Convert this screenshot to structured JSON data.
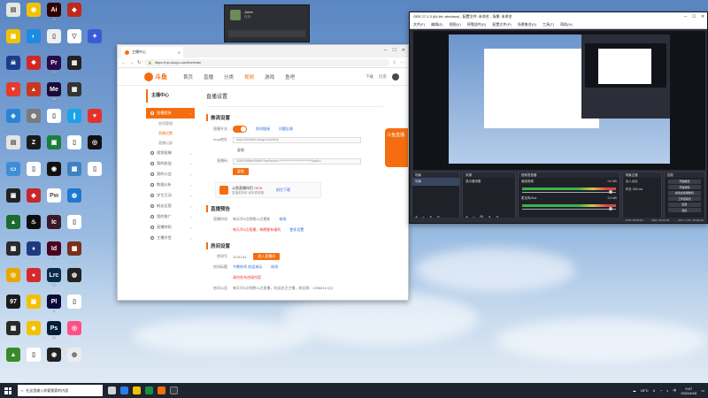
{
  "desktop_icons": [
    {
      "label": "",
      "color": "#e6e6e6",
      "glyph": "▤",
      "col": 0,
      "row": 0
    },
    {
      "label": "",
      "color": "#f2c200",
      "glyph": "◉",
      "col": 1,
      "row": 0
    },
    {
      "label": "Ai",
      "color": "#330000",
      "glyph": "Ai",
      "col": 2,
      "row": 0
    },
    {
      "label": "",
      "color": "#c2271d",
      "glyph": "◆",
      "col": 3,
      "row": 0
    },
    {
      "label": "",
      "color": "#f2c200",
      "glyph": "▣",
      "col": 0,
      "row": 1
    },
    {
      "label": "",
      "color": "#1e8ae0",
      "glyph": "◐",
      "col": 1,
      "row": 1
    },
    {
      "label": "",
      "color": "#f0f0f0",
      "glyph": "▯",
      "col": 2,
      "row": 1
    },
    {
      "label": "",
      "color": "#ffffff",
      "glyph": "▽",
      "col": 3,
      "row": 1
    },
    {
      "label": "",
      "color": "#3a5bd6",
      "glyph": "✦",
      "col": 4,
      "row": 1
    },
    {
      "label": "",
      "color": "#1c3d8c",
      "glyph": "☠",
      "col": 0,
      "row": 2
    },
    {
      "label": "",
      "color": "#d02828",
      "glyph": "❖",
      "col": 1,
      "row": 2
    },
    {
      "label": "Pr",
      "color": "#2a0a4a",
      "glyph": "Pr",
      "col": 2,
      "row": 2
    },
    {
      "label": "",
      "color": "#222222",
      "glyph": "▦",
      "col": 3,
      "row": 2
    },
    {
      "label": "",
      "color": "#e63a2e",
      "glyph": "▼",
      "col": 0,
      "row": 3
    },
    {
      "label": "",
      "color": "#c9381d",
      "glyph": "▲",
      "col": 1,
      "row": 3
    },
    {
      "label": "Me",
      "color": "#1a0a3a",
      "glyph": "Me",
      "col": 2,
      "row": 3
    },
    {
      "label": "",
      "color": "#333333",
      "glyph": "▦",
      "col": 3,
      "row": 3
    },
    {
      "label": "",
      "color": "#2a84d6",
      "glyph": "◈",
      "col": 0,
      "row": 4
    },
    {
      "label": "",
      "color": "#7a7a7a",
      "glyph": "◍",
      "col": 1,
      "row": 4
    },
    {
      "label": "",
      "color": "#ffffff",
      "glyph": "▯",
      "col": 2,
      "row": 4
    },
    {
      "label": "",
      "color": "#1aa3e8",
      "glyph": "❙",
      "col": 3,
      "row": 4
    },
    {
      "label": "",
      "color": "#e2322a",
      "glyph": "♥",
      "col": 4,
      "row": 4
    },
    {
      "label": "",
      "color": "#e5e5e5",
      "glyph": "▤",
      "col": 0,
      "row": 5
    },
    {
      "label": "",
      "color": "#1b1b1b",
      "glyph": "Z",
      "col": 1,
      "row": 5
    },
    {
      "label": "",
      "color": "#1a7f3a",
      "glyph": "▣",
      "col": 2,
      "row": 5
    },
    {
      "label": "",
      "color": "#ffffff",
      "glyph": "▯",
      "col": 3,
      "row": 5
    },
    {
      "label": "",
      "color": "#111111",
      "glyph": "◎",
      "col": 4,
      "row": 5
    },
    {
      "label": "",
      "color": "#3c8fd6",
      "glyph": "▭",
      "col": 0,
      "row": 6
    },
    {
      "label": "",
      "color": "#ffffff",
      "glyph": "▯",
      "col": 1,
      "row": 6
    },
    {
      "label": "",
      "color": "#111111",
      "glyph": "◉",
      "col": 2,
      "row": 6
    },
    {
      "label": "",
      "color": "#3b82c4",
      "glyph": "▦",
      "col": 3,
      "row": 6
    },
    {
      "label": "",
      "color": "#ffffff",
      "glyph": "▯",
      "col": 4,
      "row": 6
    },
    {
      "label": "",
      "color": "#232323",
      "glyph": "▣",
      "col": 0,
      "row": 7
    },
    {
      "label": "",
      "color": "#c62828",
      "glyph": "◆",
      "col": 1,
      "row": 7
    },
    {
      "label": "",
      "color": "#ffffff",
      "glyph": "Pw",
      "col": 2,
      "row": 7
    },
    {
      "label": "",
      "color": "#1e78d2",
      "glyph": "◍",
      "col": 3,
      "row": 7
    },
    {
      "label": "",
      "color": "#1a6b2c",
      "glyph": "▲",
      "col": 0,
      "row": 8
    },
    {
      "label": "",
      "color": "#0d0d0d",
      "glyph": "♨",
      "col": 1,
      "row": 8
    },
    {
      "label": "",
      "color": "#3a1a2a",
      "glyph": "Ic",
      "col": 2,
      "row": 8
    },
    {
      "label": "",
      "color": "#ffffff",
      "glyph": "▯",
      "col": 3,
      "row": 8
    },
    {
      "label": "",
      "color": "#2b2b2b",
      "glyph": "▦",
      "col": 0,
      "row": 9
    },
    {
      "label": "",
      "color": "#1e3a80",
      "glyph": "♦",
      "col": 1,
      "row": 9
    },
    {
      "label": "Id",
      "color": "#49021f",
      "glyph": "Id",
      "col": 2,
      "row": 9
    },
    {
      "label": "",
      "color": "#7a2e1a",
      "glyph": "▩",
      "col": 3,
      "row": 9
    },
    {
      "label": "",
      "color": "#e9a800",
      "glyph": "◎",
      "col": 0,
      "row": 10
    },
    {
      "label": "",
      "color": "#d42a2a",
      "glyph": "●",
      "col": 1,
      "row": 10
    },
    {
      "label": "Lrc",
      "color": "#0a2a4a",
      "glyph": "Lrc",
      "col": 2,
      "row": 10
    },
    {
      "label": "",
      "color": "#222222",
      "glyph": "◍",
      "col": 3,
      "row": 10
    },
    {
      "label": "",
      "color": "#1b1b1b",
      "glyph": "97",
      "col": 0,
      "row": 11
    },
    {
      "label": "",
      "color": "#f2c200",
      "glyph": "▣",
      "col": 1,
      "row": 11
    },
    {
      "label": "Pl",
      "color": "#0a0a3a",
      "glyph": "Pl",
      "col": 2,
      "row": 11
    },
    {
      "label": "",
      "color": "#ffffff",
      "glyph": "▯",
      "col": 3,
      "row": 11
    },
    {
      "label": "",
      "color": "#2a2a2a",
      "glyph": "▦",
      "col": 0,
      "row": 12
    },
    {
      "label": "",
      "color": "#f2c200",
      "glyph": "◆",
      "col": 1,
      "row": 12
    },
    {
      "label": "Ps",
      "color": "#001e36",
      "glyph": "Ps",
      "col": 2,
      "row": 12
    },
    {
      "label": "",
      "color": "#ff4f86",
      "glyph": "◎",
      "col": 3,
      "row": 12
    },
    {
      "label": "",
      "color": "#3a8a2a",
      "glyph": "▲",
      "col": 0,
      "row": 13
    },
    {
      "label": "",
      "color": "#ffffff",
      "glyph": "▯",
      "col": 1,
      "row": 13
    },
    {
      "label": "",
      "color": "#222222",
      "glyph": "◉",
      "col": 2,
      "row": 13
    },
    {
      "label": "",
      "color": "#ececec",
      "glyph": "◍",
      "col": 3,
      "row": 13
    }
  ],
  "chat": {
    "name": "Jober",
    "status": "在线"
  },
  "browser": {
    "tab_title": "主播中心",
    "url": "https://mp.douyu.com/live/main",
    "site_logo": "斗鱼",
    "nav": [
      "首页",
      "直播",
      "分类",
      "视频",
      "游戏",
      "鱼吧"
    ],
    "right_items": [
      "下载",
      "历史"
    ],
    "sidebar_title": "主播中心",
    "sidebar": [
      {
        "label": "直播相关",
        "active": true
      },
      {
        "label": "房间管理",
        "sub": true,
        "on": false
      },
      {
        "label": "直播设置",
        "sub": true,
        "on": true
      },
      {
        "label": "直播记录",
        "sub": true,
        "on": false
      },
      {
        "label": "视频投稿",
        "active": false
      },
      {
        "label": "我的收益",
        "active": false
      },
      {
        "label": "我的公会",
        "active": false
      },
      {
        "label": "数据分析",
        "active": false
      },
      {
        "label": "学生互动",
        "active": false
      },
      {
        "label": "粉丝运营",
        "active": false
      },
      {
        "label": "我的推广",
        "active": false
      },
      {
        "label": "直播特权",
        "active": false
      },
      {
        "label": "主播学堂",
        "active": false
      }
    ],
    "page_title": "直播设置",
    "sec1": "推流设置",
    "stream_label": "直播开关",
    "link1": "房间链接",
    "link2": "问题反馈",
    "rtmp_label": "rtmp地址",
    "rtmp_value": "rtmp://sendtc3.douyu.com/live",
    "copy_btn": "复制",
    "key_label": "直播码",
    "key_value": "10501968rb3MdW?wsSecret=**************************&auth=",
    "copy_btn2": "复制",
    "promo_title": "斗鱼直播伴侣",
    "promo_sub": "直播更简单 使用更便捷",
    "promo_new": "NEW",
    "promo_link": "前往下载",
    "sec2": "直播预告",
    "preview_label": "直播时间",
    "preview_value": "每天早9点到晚11点更新",
    "preview_edit": "修改",
    "preview_red": "每天早9点直播，每晚都有福利",
    "preview_blue": "更多设置",
    "sec3": "房间设置",
    "room_label": "房间号",
    "room_value": "1231154",
    "room_btn": "进入直播间",
    "title_label": "房间标题",
    "title_value": "今晚吃鸡 欢迎来玩",
    "title_edit": "修改",
    "title_red": "请勿发布违规内容",
    "notice_label": "房间公告",
    "notice_value": "每天早9点到晚11点直播，欢迎关注主播，粉丝群：1598616 QQ",
    "banner_text": "斗鱼直播"
  },
  "obs": {
    "title": "OBS 27.1.3 (64-bit, windows) - 配置文件: 未命名 - 场景: 未命名",
    "menu": [
      "文件(F)",
      "编辑(E)",
      "视图(V)",
      "停靠部件(D)",
      "配置文件(P)",
      "场景集合(S)",
      "工具(T)",
      "帮助(H)"
    ],
    "docks": {
      "scenes_title": "场景",
      "scenes_items": [
        "场景"
      ],
      "sources_title": "来源",
      "sources_items": [
        "显示器采集"
      ],
      "mixer_title": "音频混音器",
      "mixer_items": [
        "桌面音频",
        "麦克风/Aux"
      ],
      "mixer_db": [
        "0.0 dB",
        "0.0 dB"
      ],
      "trans_title": "场景过渡",
      "trans_items": [
        "淡入淡出",
        "时长",
        "300 ms"
      ],
      "controls_title": "控制",
      "controls": [
        "开始推流",
        "开始录制",
        "启动虚拟摄像机",
        "工作室模式",
        "设置",
        "退出"
      ]
    },
    "status": [
      "LIVE: 00:00:00",
      "REC: 00:00:00",
      "CPU: 2.1%, 30.00 fps"
    ]
  },
  "taskbar": {
    "search_placeholder": "在这里输入你要搜索的内容",
    "weather": "15°C",
    "time": "9:07",
    "date": "2022/4/18"
  }
}
